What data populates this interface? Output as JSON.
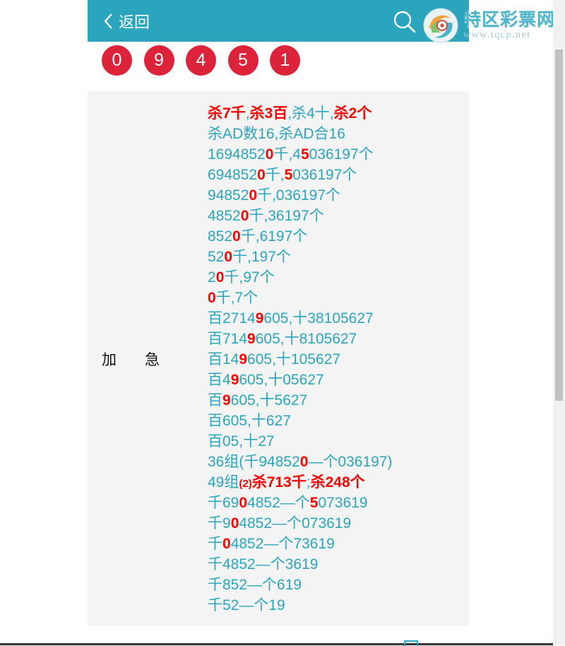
{
  "header": {
    "back_label": "返回",
    "bg_color": "#2ba5be"
  },
  "logo": {
    "name": "特区彩票网",
    "url": "www.tqcp.net"
  },
  "balls": [
    "0",
    "9",
    "4",
    "5",
    "1"
  ],
  "panel": {
    "label_left": "加",
    "label_right": "急",
    "lines": [
      [
        {
          "t": "杀7千",
          "h": true
        },
        {
          "t": ","
        },
        {
          "t": "杀3百",
          "h": true
        },
        {
          "t": ",杀4十,"
        },
        {
          "t": "杀2个",
          "h": true
        }
      ],
      [
        {
          "t": "杀AD数16,杀AD合16"
        }
      ],
      [
        {
          "t": "1694852"
        },
        {
          "t": "0",
          "h": true
        },
        {
          "t": "千,4"
        },
        {
          "t": "5",
          "h": true
        },
        {
          "t": "036197个"
        }
      ],
      [
        {
          "t": "694852"
        },
        {
          "t": "0",
          "h": true
        },
        {
          "t": "千,"
        },
        {
          "t": "5",
          "h": true
        },
        {
          "t": "036197个"
        }
      ],
      [
        {
          "t": "94852"
        },
        {
          "t": "0",
          "h": true
        },
        {
          "t": "千,036197个"
        }
      ],
      [
        {
          "t": "4852"
        },
        {
          "t": "0",
          "h": true
        },
        {
          "t": "千,36197个"
        }
      ],
      [
        {
          "t": "852"
        },
        {
          "t": "0",
          "h": true
        },
        {
          "t": "千,6197个"
        }
      ],
      [
        {
          "t": "52"
        },
        {
          "t": "0",
          "h": true
        },
        {
          "t": "千,197个"
        }
      ],
      [
        {
          "t": "2"
        },
        {
          "t": "0",
          "h": true
        },
        {
          "t": "千,97个"
        }
      ],
      [
        {
          "t": "0",
          "h": true
        },
        {
          "t": "千,7个"
        }
      ],
      [
        {
          "t": "百2714"
        },
        {
          "t": "9",
          "h": true
        },
        {
          "t": "605,十38105627"
        }
      ],
      [
        {
          "t": "百714"
        },
        {
          "t": "9",
          "h": true
        },
        {
          "t": "605,十8105627"
        }
      ],
      [
        {
          "t": "百14"
        },
        {
          "t": "9",
          "h": true
        },
        {
          "t": "605,十105627"
        }
      ],
      [
        {
          "t": "百4"
        },
        {
          "t": "9",
          "h": true
        },
        {
          "t": "605,十05627"
        }
      ],
      [
        {
          "t": "百"
        },
        {
          "t": "9",
          "h": true
        },
        {
          "t": "605,十5627"
        }
      ],
      [
        {
          "t": "百605,十627"
        }
      ],
      [
        {
          "t": "百05,十27"
        }
      ],
      [
        {
          "t": "36组(千94852"
        },
        {
          "t": "0",
          "h": true
        },
        {
          "t": "—个036197)"
        }
      ],
      [
        {
          "t": "49组"
        },
        {
          "t": "(2)",
          "h": true,
          "s": true
        },
        {
          "t": "杀713千",
          "h": true
        },
        {
          "t": ";"
        },
        {
          "t": "杀248个",
          "h": true
        }
      ],
      [
        {
          "t": "千69"
        },
        {
          "t": "0",
          "h": true
        },
        {
          "t": "4852—个"
        },
        {
          "t": "5",
          "h": true
        },
        {
          "t": "073619"
        }
      ],
      [
        {
          "t": "千9"
        },
        {
          "t": "0",
          "h": true
        },
        {
          "t": "4852—个073619"
        }
      ],
      [
        {
          "t": "千"
        },
        {
          "t": "0",
          "h": true
        },
        {
          "t": "4852—个73619"
        }
      ],
      [
        {
          "t": "千4852—个3619"
        }
      ],
      [
        {
          "t": "千852—个619"
        }
      ],
      [
        {
          "t": "千52—个19"
        }
      ]
    ]
  },
  "colors": {
    "teal": "#2ba5be",
    "ball_red": "#dc2339",
    "highlight_red": "#ff0000",
    "panel_bg": "#f4f4f4"
  }
}
